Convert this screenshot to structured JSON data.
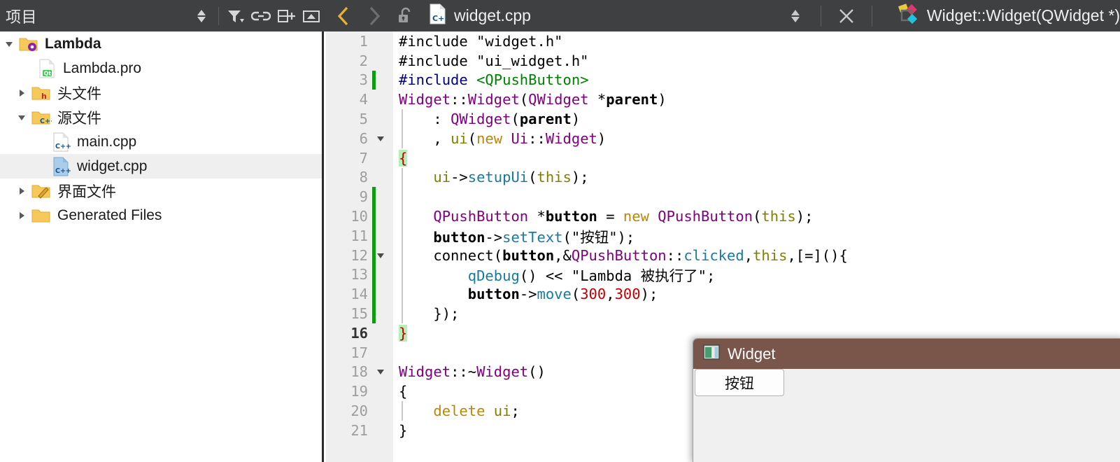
{
  "topbar": {
    "project_panel_title": "项目",
    "panel_icons": [
      {
        "name": "sync-updown-icon",
        "glyph": "updown"
      },
      {
        "name": "filter-icon",
        "glyph": "filter"
      },
      {
        "name": "link-icon",
        "glyph": "link"
      },
      {
        "name": "split-add-icon",
        "glyph": "splitadd"
      },
      {
        "name": "collapse-panel-icon",
        "glyph": "collapse"
      }
    ],
    "nav_back": "‹",
    "nav_forward": "›",
    "lock_state": "unlocked",
    "file_name": "widget.cpp",
    "file_icon": "cpp-file-icon",
    "symbol_name": "Widget::Widget(QWidget *)",
    "symbol_icon": "qt-symbol-icon",
    "close_label": "✕"
  },
  "sidebar": {
    "items": [
      {
        "label": "Lambda",
        "indent": 0,
        "twisty": "down",
        "icon": "project-folder-icon",
        "bold": true,
        "selected": false
      },
      {
        "label": "Lambda.pro",
        "indent": 1,
        "twisty": "none",
        "icon": "qt-pro-file-icon",
        "bold": false,
        "selected": false
      },
      {
        "label": "头文件",
        "indent": 1,
        "twisty": "right",
        "icon": "header-folder-icon",
        "bold": false,
        "selected": false
      },
      {
        "label": "源文件",
        "indent": 1,
        "twisty": "down",
        "icon": "source-folder-icon",
        "bold": false,
        "selected": false
      },
      {
        "label": "main.cpp",
        "indent": 2,
        "twisty": "none",
        "icon": "cpp-file-icon",
        "bold": false,
        "selected": false
      },
      {
        "label": "widget.cpp",
        "indent": 2,
        "twisty": "none",
        "icon": "cpp-file-active-icon",
        "bold": false,
        "selected": true
      },
      {
        "label": "界面文件",
        "indent": 1,
        "twisty": "right",
        "icon": "ui-folder-icon",
        "bold": false,
        "selected": false
      },
      {
        "label": "Generated Files",
        "indent": 1,
        "twisty": "right",
        "icon": "plain-folder-icon",
        "bold": false,
        "selected": false
      }
    ]
  },
  "editor": {
    "current_line": 16,
    "lines": [
      {
        "n": 1,
        "fold": false,
        "changed": false,
        "indent_guide": false,
        "text": "#include \"widget.h\""
      },
      {
        "n": 2,
        "fold": false,
        "changed": false,
        "indent_guide": false,
        "text": "#include \"ui_widget.h\""
      },
      {
        "n": 3,
        "fold": false,
        "changed": true,
        "indent_guide": false,
        "text": "#include <QPushButton>"
      },
      {
        "n": 4,
        "fold": false,
        "changed": false,
        "indent_guide": false,
        "text": "Widget::Widget(QWidget *parent)"
      },
      {
        "n": 5,
        "fold": false,
        "changed": false,
        "indent_guide": true,
        "text": "    : QWidget(parent)"
      },
      {
        "n": 6,
        "fold": true,
        "changed": false,
        "indent_guide": true,
        "text": "    , ui(new Ui::Widget)"
      },
      {
        "n": 7,
        "fold": false,
        "changed": false,
        "indent_guide": false,
        "text": "{"
      },
      {
        "n": 8,
        "fold": false,
        "changed": false,
        "indent_guide": true,
        "text": "    ui->setupUi(this);"
      },
      {
        "n": 9,
        "fold": false,
        "changed": true,
        "indent_guide": true,
        "text": ""
      },
      {
        "n": 10,
        "fold": false,
        "changed": true,
        "indent_guide": true,
        "text": "    QPushButton *button = new QPushButton(this);"
      },
      {
        "n": 11,
        "fold": false,
        "changed": true,
        "indent_guide": true,
        "text": "    button->setText(\"按钮\");"
      },
      {
        "n": 12,
        "fold": true,
        "changed": true,
        "indent_guide": true,
        "text": "    connect(button,&QPushButton::clicked,this,[=](){"
      },
      {
        "n": 13,
        "fold": false,
        "changed": true,
        "indent_guide": true,
        "text": "        qDebug() << \"Lambda 被执行了\";"
      },
      {
        "n": 14,
        "fold": false,
        "changed": true,
        "indent_guide": true,
        "text": "        button->move(300,300);"
      },
      {
        "n": 15,
        "fold": false,
        "changed": true,
        "indent_guide": true,
        "text": "    });"
      },
      {
        "n": 16,
        "fold": false,
        "changed": false,
        "indent_guide": false,
        "text": "}"
      },
      {
        "n": 17,
        "fold": false,
        "changed": false,
        "indent_guide": false,
        "text": ""
      },
      {
        "n": 18,
        "fold": true,
        "changed": false,
        "indent_guide": false,
        "text": "Widget::~Widget()"
      },
      {
        "n": 19,
        "fold": false,
        "changed": false,
        "indent_guide": false,
        "text": "{"
      },
      {
        "n": 20,
        "fold": false,
        "changed": false,
        "indent_guide": true,
        "text": "    delete ui;"
      },
      {
        "n": 21,
        "fold": false,
        "changed": false,
        "indent_guide": false,
        "text": "}"
      }
    ]
  },
  "app_window": {
    "title": "Widget",
    "icon": "qt-window-icon",
    "button_label": "按钮"
  },
  "colors": {
    "toolbar_bg": "#3e4042",
    "gutter_bg": "#efefef",
    "change_marker": "#109b10",
    "selection_bg": "#efefef",
    "qt_titlebar": "#7a5549",
    "nav_back_active": "#e8b22a",
    "string_green": "#008000",
    "class_purple": "#800080"
  }
}
